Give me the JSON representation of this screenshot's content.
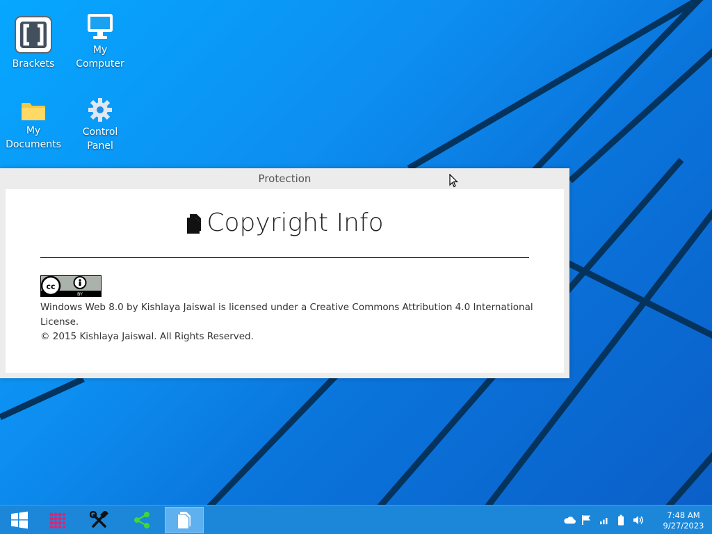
{
  "desktop": {
    "icons": [
      {
        "label": "Brackets",
        "icon": "brackets-icon"
      },
      {
        "label": "My Computer",
        "icon": "computer-icon"
      },
      {
        "label": "My Documents",
        "icon": "folder-icon"
      },
      {
        "label": "Control Panel",
        "icon": "gear-icon"
      }
    ]
  },
  "window": {
    "title": "Protection",
    "heading": "Copyright Info",
    "heading_icon": "document-icon",
    "badge": {
      "icon": "creative-commons-by-badge",
      "by_label": "BY"
    },
    "license_line1": "Windows Web 8.0 by Kishlaya Jaiswal is licensed under a Creative Commons Attribution 4.0 International License.",
    "license_line2": "© 2015 Kishlaya Jaiswal. All Rights Reserved."
  },
  "taskbar": {
    "buttons": [
      {
        "icon": "windows-start-icon",
        "active": false
      },
      {
        "icon": "apps-grid-icon",
        "active": false
      },
      {
        "icon": "tools-icon",
        "active": false
      },
      {
        "icon": "share-icon",
        "active": false
      },
      {
        "icon": "document-icon",
        "active": true
      }
    ],
    "tray": {
      "icons": [
        "cloud-icon",
        "flag-icon",
        "signal-icon",
        "battery-icon",
        "volume-icon"
      ],
      "time": "7:48 AM",
      "date": "9/27/2023"
    }
  },
  "colors": {
    "wallpaper": "#0d8ef0",
    "taskbar": "#1c87d9",
    "window_frame": "#ececec",
    "window_body": "#ffffff",
    "apps_icon": "#e5206f",
    "share_icon": "#41d639"
  }
}
